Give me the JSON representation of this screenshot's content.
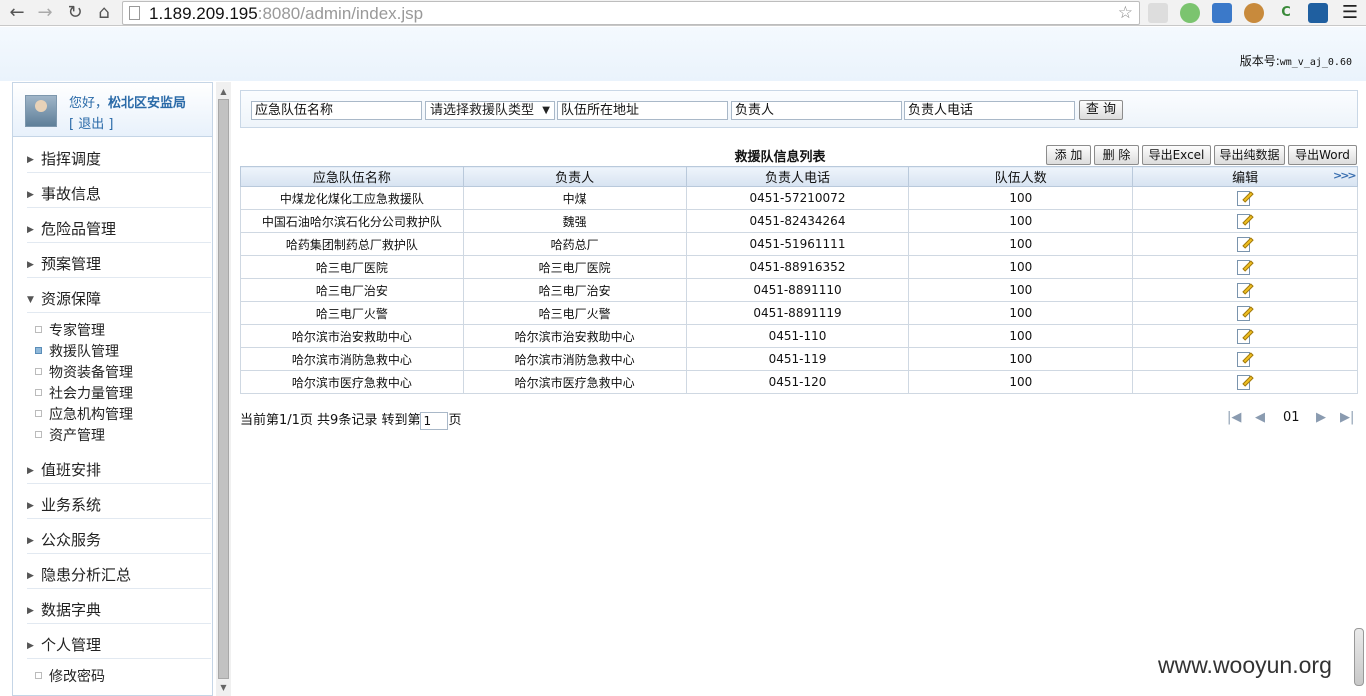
{
  "browser": {
    "url_host": "1.189.209.195",
    "url_rest": ":8080/admin/index.jsp"
  },
  "header": {
    "version_label": "版本号:",
    "version_value": "wm_v_aj_0.60"
  },
  "user": {
    "greeting_prefix": "您好，",
    "name": "松北区安监局",
    "logout": "[ 退出 ]"
  },
  "sidebar": {
    "menus": [
      {
        "label": "指挥调度",
        "expanded": false
      },
      {
        "label": "事故信息",
        "expanded": false
      },
      {
        "label": "危险品管理",
        "expanded": false
      },
      {
        "label": "预案管理",
        "expanded": false
      },
      {
        "label": "资源保障",
        "expanded": true
      },
      {
        "label": "值班安排",
        "expanded": false
      },
      {
        "label": "业务系统",
        "expanded": false
      },
      {
        "label": "公众服务",
        "expanded": false
      },
      {
        "label": "隐患分析汇总",
        "expanded": false
      },
      {
        "label": "数据字典",
        "expanded": false
      },
      {
        "label": "个人管理",
        "expanded": true
      }
    ],
    "resource_items": [
      "专家管理",
      "救援队管理",
      "物资装备管理",
      "社会力量管理",
      "应急机构管理",
      "资产管理"
    ],
    "active_item": "救援队管理",
    "personal_items": [
      "修改密码"
    ]
  },
  "filters": {
    "team_name": "应急队伍名称",
    "team_type": "请选择救援队类型",
    "address": "队伍所在地址",
    "leader": "负责人",
    "leader_phone": "负责人电话",
    "query_button": "查 询"
  },
  "table": {
    "title": "救援队信息列表",
    "buttons": {
      "add": "添 加",
      "delete": "删 除",
      "export_excel": "导出Excel",
      "export_data": "导出纯数据",
      "export_word": "导出Word"
    },
    "columns": [
      "应急队伍名称",
      "负责人",
      "负责人电话",
      "队伍人数",
      "编辑"
    ],
    "rows": [
      [
        "中煤龙化煤化工应急救援队",
        "中煤",
        "0451-57210072",
        "100"
      ],
      [
        "中国石油哈尔滨石化分公司救护队",
        "魏强",
        "0451-82434264",
        "100"
      ],
      [
        "哈药集团制药总厂救护队",
        "哈药总厂",
        "0451-51961111",
        "100"
      ],
      [
        "哈三电厂医院",
        "哈三电厂医院",
        "0451-88916352",
        "100"
      ],
      [
        "哈三电厂治安",
        "哈三电厂治安",
        "0451-8891110",
        "100"
      ],
      [
        "哈三电厂火警",
        "哈三电厂火警",
        "0451-8891119",
        "100"
      ],
      [
        "哈尔滨市治安救助中心",
        "哈尔滨市治安救助中心",
        "0451-110",
        "100"
      ],
      [
        "哈尔滨市消防急救中心",
        "哈尔滨市消防急救中心",
        "0451-119",
        "100"
      ],
      [
        "哈尔滨市医疗急救中心",
        "哈尔滨市医疗急救中心",
        "0451-120",
        "100"
      ]
    ]
  },
  "pager": {
    "summary": "当前第1/1页 共9条记录 转到第",
    "page_input": "1",
    "suffix": "页",
    "current": "01"
  },
  "watermark": "www.wooyun.org"
}
